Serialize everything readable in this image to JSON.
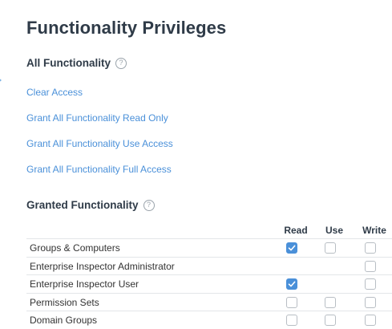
{
  "page": {
    "title": "Functionality Privileges"
  },
  "all_functionality": {
    "heading": "All Functionality",
    "help_glyph": "?",
    "links": [
      "Clear Access",
      "Grant All Functionality Read Only",
      "Grant All Functionality Use Access",
      "Grant All Functionality Full Access"
    ]
  },
  "granted_functionality": {
    "heading": "Granted Functionality",
    "help_glyph": "?",
    "columns": [
      "Read",
      "Use",
      "Write"
    ],
    "rows": [
      {
        "label": "Groups & Computers",
        "read": true,
        "use": false,
        "write": false,
        "use_visible": true,
        "read_visible": true
      },
      {
        "label": "Enterprise Inspector Administrator",
        "read": false,
        "use": false,
        "write": false,
        "use_visible": false,
        "read_visible": false
      },
      {
        "label": "Enterprise Inspector User",
        "read": true,
        "use": false,
        "write": false,
        "use_visible": false,
        "read_visible": true
      },
      {
        "label": "Permission Sets",
        "read": false,
        "use": false,
        "write": false,
        "use_visible": true,
        "read_visible": true
      },
      {
        "label": "Domain Groups",
        "read": false,
        "use": false,
        "write": false,
        "use_visible": true,
        "read_visible": true
      }
    ]
  },
  "colors": {
    "link": "#4a90d9",
    "checkbox_checked": "#4a90d9",
    "heading": "#2f3b48"
  }
}
